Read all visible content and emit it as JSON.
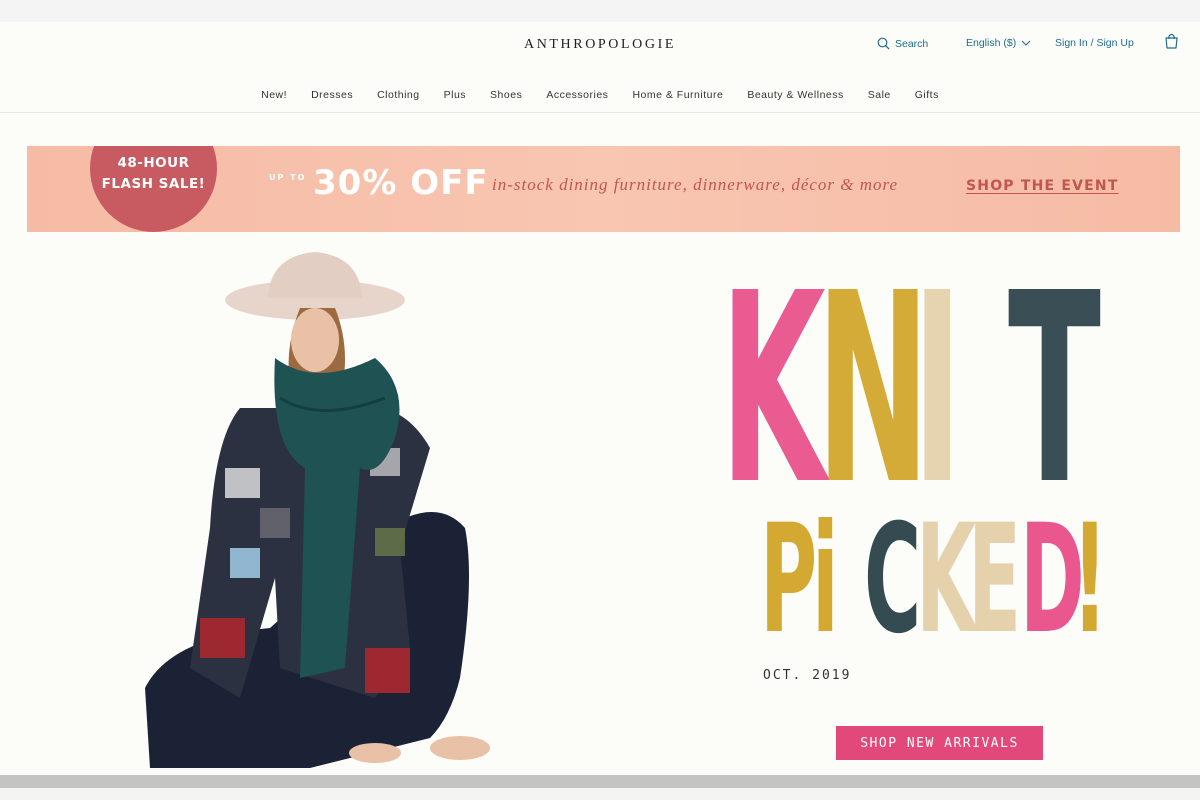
{
  "header": {
    "logo": "ANTHROPOLOGIE",
    "search_label": "Search",
    "language_label": "English ($)",
    "signin_label": "Sign In / Sign Up",
    "icons": [
      "search-icon",
      "chevron-down-icon",
      "shopping-bag-icon"
    ],
    "accent_color": "#1f6e8a"
  },
  "nav": {
    "items": [
      "New!",
      "Dresses",
      "Clothing",
      "Plus",
      "Shoes",
      "Accessories",
      "Home & Furniture",
      "Beauty & Wellness",
      "Sale",
      "Gifts"
    ]
  },
  "banner": {
    "flash_line1": "48-HOUR",
    "flash_line2": "FLASH SALE!",
    "upto": "UP TO",
    "percent": "30% OFF",
    "offer_text": "in-stock dining furniture, dinnerware, décor & more",
    "cta": "SHOP THE EVENT",
    "background_color": "#f6bba5",
    "circle_color": "#c85b61"
  },
  "hero": {
    "headline_word1": [
      "K",
      "N",
      "I",
      "T"
    ],
    "headline_word1_colors": [
      "#e84a86",
      "#d0a322",
      "#e4cfa7",
      "#243c44"
    ],
    "headline_word2": [
      "P",
      "i",
      "C",
      "K",
      "E",
      "D",
      "!"
    ],
    "headline_word2_colors": [
      "#d0a322",
      "#d0a322",
      "#243c44",
      "#e4cfa7",
      "#e4cfa7",
      "#e84a86",
      "#d0a322"
    ],
    "date": "OCT. 2019",
    "cta": "SHOP NEW ARRIVALS",
    "cta_color": "#e2497a"
  }
}
